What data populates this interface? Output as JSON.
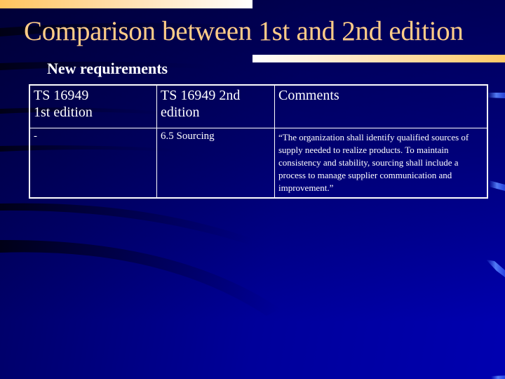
{
  "slide": {
    "title": "Comparison between 1st and 2nd edition",
    "subtitle": "New requirements"
  },
  "table": {
    "headers": [
      "TS 16949\n1st edition",
      "TS 16949  2nd edition",
      "Comments"
    ],
    "header_lines": {
      "col1_line1": "TS 16949",
      "col1_line2": "1st edition",
      "col2": "TS 16949  2nd edition",
      "col3": "Comments"
    },
    "rows": [
      {
        "first_edition": "-",
        "second_edition": "6.5 Sourcing",
        "comment": "“The organization shall identify qualified sources of supply needed to realize products. To maintain consistency and stability, sourcing shall include a process to manage supplier communication and improvement.”"
      }
    ]
  },
  "colors": {
    "background": "#0000a8",
    "title": "#ffcc88",
    "accent_bar": "#ffc966",
    "text": "#ffffff"
  }
}
